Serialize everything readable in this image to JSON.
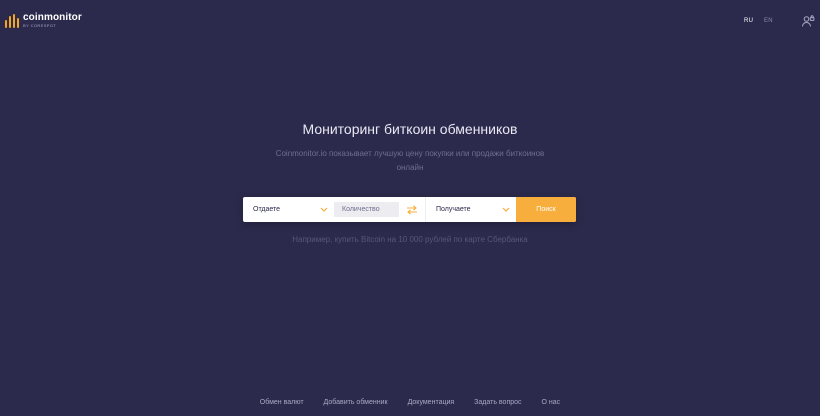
{
  "header": {
    "logo_name": "coinmonitor",
    "logo_sub": "BY CORESPOT",
    "lang_ru": "RU",
    "lang_en": "EN"
  },
  "hero": {
    "title": "Мониторинг биткоин обменников",
    "subtitle": "Coinmonitor.io показывает лучшую цену покупки или продажи биткоинов онлайн"
  },
  "search": {
    "give_label": "Отдаете",
    "amount_placeholder": "Количество",
    "get_label": "Получаете",
    "search_button": "Поиск"
  },
  "example": {
    "prefix": "Например, ",
    "link": "купить Bitcoin на 10 000 рублей по карте Сбербанка"
  },
  "footer": {
    "links": [
      "Обмен валют",
      "Добавить обменник",
      "Документация",
      "Задать вопрос",
      "О нас"
    ]
  },
  "colors": {
    "background": "#2b2a4c",
    "accent": "#f7ae3c",
    "text_muted": "#6f6e8e"
  },
  "icons": {
    "logo": "bar-chart-logo-icon",
    "dropdown": "chevron-down-icon",
    "swap": "swap-arrows-icon",
    "user": "user-lock-icon"
  }
}
